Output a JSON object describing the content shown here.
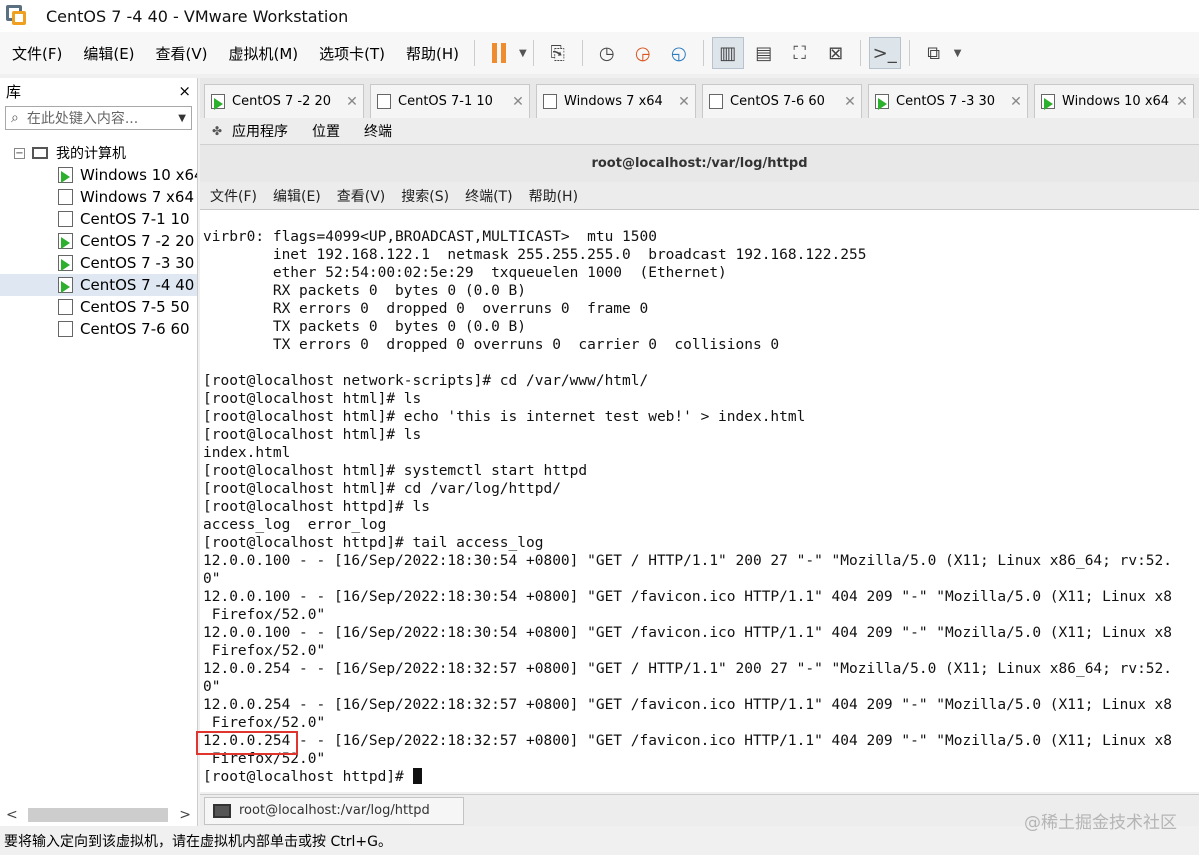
{
  "window": {
    "title": "CentOS 7 -4 40 - VMware Workstation"
  },
  "menubar": {
    "items": [
      "文件(F)",
      "编辑(E)",
      "查看(V)",
      "虚拟机(M)",
      "选项卡(T)",
      "帮助(H)"
    ]
  },
  "library": {
    "title": "库",
    "close": "×",
    "search_placeholder": "在此处键入内容...",
    "root": "我的计算机",
    "items": [
      {
        "label": "Windows 10 x64",
        "running": true
      },
      {
        "label": "Windows 7 x64",
        "running": false
      },
      {
        "label": "CentOS 7-1  10",
        "running": false
      },
      {
        "label": "CentOS 7 -2 20",
        "running": true
      },
      {
        "label": "CentOS 7 -3 30",
        "running": true
      },
      {
        "label": "CentOS 7 -4 40",
        "running": true,
        "selected": true
      },
      {
        "label": "CentOS 7-5 50",
        "running": false
      },
      {
        "label": "CentOS 7-6  60",
        "running": false
      }
    ]
  },
  "tabs": [
    {
      "label": "CentOS 7 -2 20",
      "running": true
    },
    {
      "label": "CentOS 7-1  10",
      "running": false
    },
    {
      "label": "Windows 7 x64",
      "running": false
    },
    {
      "label": "CentOS 7-6  60",
      "running": false
    },
    {
      "label": "CentOS 7 -3 30",
      "running": true
    },
    {
      "label": "Windows 10 x64",
      "running": true
    }
  ],
  "gnome": {
    "applications": "应用程序",
    "places": "位置",
    "terminal": "终端"
  },
  "terminal": {
    "title": "root@localhost:/var/log/httpd",
    "menu": [
      "文件(F)",
      "编辑(E)",
      "查看(V)",
      "搜索(S)",
      "终端(T)",
      "帮助(H)"
    ],
    "lines": [
      "virbr0: flags=4099<UP,BROADCAST,MULTICAST>  mtu 1500",
      "        inet 192.168.122.1  netmask 255.255.255.0  broadcast 192.168.122.255",
      "        ether 52:54:00:02:5e:29  txqueuelen 1000  (Ethernet)",
      "        RX packets 0  bytes 0 (0.0 B)",
      "        RX errors 0  dropped 0  overruns 0  frame 0",
      "        TX packets 0  bytes 0 (0.0 B)",
      "        TX errors 0  dropped 0 overruns 0  carrier 0  collisions 0",
      "",
      "[root@localhost network-scripts]# cd /var/www/html/",
      "[root@localhost html]# ls",
      "[root@localhost html]# echo 'this is internet test web!' > index.html",
      "[root@localhost html]# ls",
      "index.html",
      "[root@localhost html]# systemctl start httpd",
      "[root@localhost html]# cd /var/log/httpd/",
      "[root@localhost httpd]# ls",
      "access_log  error_log",
      "[root@localhost httpd]# tail access_log",
      "12.0.0.100 - - [16/Sep/2022:18:30:54 +0800] \"GET / HTTP/1.1\" 200 27 \"-\" \"Mozilla/5.0 (X11; Linux x86_64; rv:52.",
      "0\"",
      "12.0.0.100 - - [16/Sep/2022:18:30:54 +0800] \"GET /favicon.ico HTTP/1.1\" 404 209 \"-\" \"Mozilla/5.0 (X11; Linux x8",
      " Firefox/52.0\"",
      "12.0.0.100 - - [16/Sep/2022:18:30:54 +0800] \"GET /favicon.ico HTTP/1.1\" 404 209 \"-\" \"Mozilla/5.0 (X11; Linux x8",
      " Firefox/52.0\"",
      "12.0.0.254 - - [16/Sep/2022:18:32:57 +0800] \"GET / HTTP/1.1\" 200 27 \"-\" \"Mozilla/5.0 (X11; Linux x86_64; rv:52.",
      "0\"",
      "12.0.0.254 - - [16/Sep/2022:18:32:57 +0800] \"GET /favicon.ico HTTP/1.1\" 404 209 \"-\" \"Mozilla/5.0 (X11; Linux x8",
      " Firefox/52.0\"",
      "12.0.0.254 - - [16/Sep/2022:18:32:57 +0800] \"GET /favicon.ico HTTP/1.1\" 404 209 \"-\" \"Mozilla/5.0 (X11; Linux x8",
      " Firefox/52.0\""
    ],
    "prompt": "[root@localhost httpd]# "
  },
  "vm_taskbar": {
    "task_label": "root@localhost:/var/log/httpd"
  },
  "statusbar": {
    "text": "要将输入定向到该虚拟机，请在虚拟机内部单击或按 Ctrl+G。"
  },
  "watermark": "@稀土掘金技术社区",
  "colors": {
    "pause_accent": "#f08c30",
    "running_icon": "#2db02d",
    "highlight_box": "#e0342f"
  }
}
